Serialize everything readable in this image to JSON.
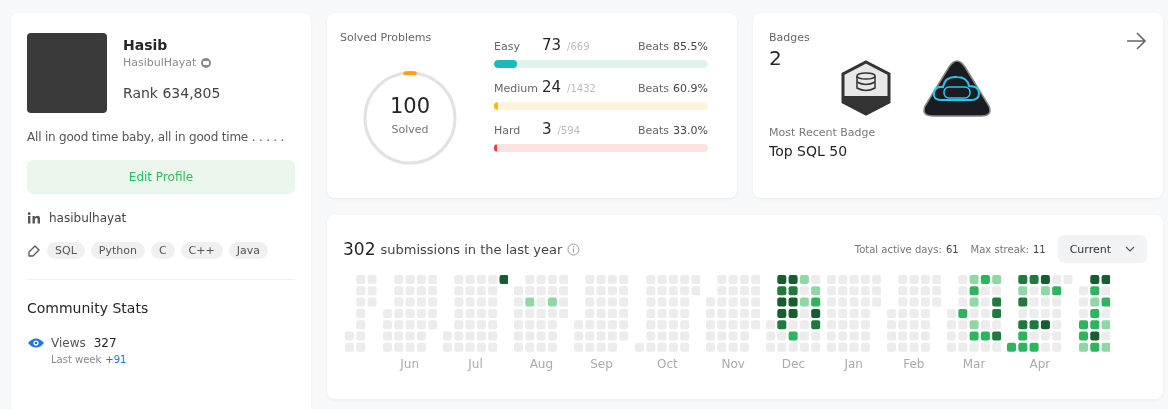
{
  "profile": {
    "name": "Hasib",
    "username": "HasibulHayat",
    "rank": "Rank 634,805",
    "bio": "All in good time baby, all in good time . . . . .",
    "edit_button": "Edit Profile",
    "linkedin": "hasibulhayat",
    "skills": [
      "SQL",
      "Python",
      "C",
      "C++",
      "Java"
    ]
  },
  "community_stats": {
    "title": "Community Stats",
    "items": [
      {
        "label": "Views",
        "value": "327",
        "sub_label": "Last week",
        "sub_value": "+91"
      }
    ]
  },
  "solved": {
    "title": "Solved Problems",
    "total": "100",
    "total_label": "Solved",
    "ring": {
      "level": 0.034
    },
    "difficulties": [
      {
        "kind": "easy",
        "label": "Easy",
        "solved": "73",
        "total": "/669",
        "beats_label": "Beats",
        "beats": "85.5%",
        "level": 0.109
      },
      {
        "kind": "medium",
        "label": "Medium",
        "solved": "24",
        "total": "/1432",
        "beats_label": "Beats",
        "beats": "60.9%",
        "level": 0.017
      },
      {
        "kind": "hard",
        "label": "Hard",
        "solved": "3",
        "total": "/594",
        "beats_label": "Beats",
        "beats": "33.0%",
        "level": 0.005
      }
    ]
  },
  "badges": {
    "title": "Badges",
    "count": "2",
    "items": [
      {
        "kind": "hexagon"
      },
      {
        "kind": "cloud"
      }
    ],
    "recent_label": "Most Recent Badge",
    "recent_name": "Top SQL 50"
  },
  "submissions": {
    "count": "302",
    "text": "submissions in the last year",
    "active_days_label": "Total active days:",
    "active_days": "61",
    "streak_label": "Max streak:",
    "streak": "11",
    "period": "Current",
    "month_labels": [
      "Jun",
      "Jul",
      "Aug",
      "Sep",
      "Oct",
      "Nov",
      "Dec",
      "Jan",
      "Feb",
      "Mar",
      "Apr"
    ]
  }
}
